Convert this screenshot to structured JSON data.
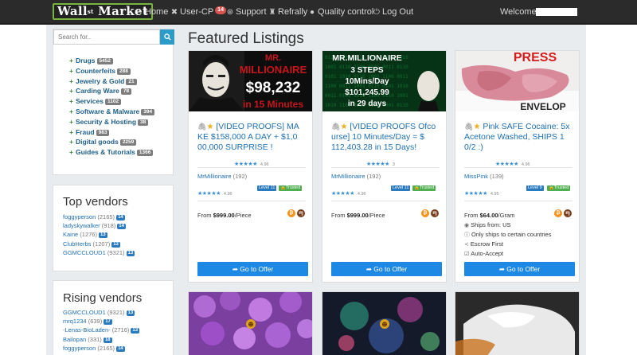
{
  "navbar": {
    "brand": "Wall",
    "brand_sup": "st",
    "brand_suffix": "Market",
    "links": [
      {
        "label": "Home",
        "icon": "home-icon"
      },
      {
        "label": "User-CP",
        "icon": "user-cp-icon",
        "badge": "14"
      },
      {
        "label": "Support",
        "icon": "support-icon"
      },
      {
        "label": "Refrally",
        "icon": "trophy-icon"
      },
      {
        "label": "Quality control",
        "icon": "quality-icon"
      },
      {
        "label": "Log Out",
        "icon": "logout-icon"
      }
    ],
    "welcome": "Welcome,"
  },
  "search": {
    "placeholder": "Search for.."
  },
  "categories": [
    {
      "name": "Drugs",
      "count": "5452"
    },
    {
      "name": "Counterfeits",
      "count": "288"
    },
    {
      "name": "Jewelry & Gold",
      "count": "21"
    },
    {
      "name": "Carding Ware",
      "count": "78"
    },
    {
      "name": "Services",
      "count": "1102"
    },
    {
      "name": "Software & Malware",
      "count": "394"
    },
    {
      "name": "Security & Hosting",
      "count": "38"
    },
    {
      "name": "Fraud",
      "count": "983"
    },
    {
      "name": "Digital goods",
      "count": "2259"
    },
    {
      "name": "Guides & Tutorials",
      "count": "1366"
    }
  ],
  "top_vendors": {
    "title": "Top vendors",
    "items": [
      {
        "name": "foggyperson",
        "count": "(2165)",
        "level": "14"
      },
      {
        "name": "ladyskywalker",
        "count": "(918)",
        "level": "14"
      },
      {
        "name": "Kaine",
        "count": "(1276)",
        "level": "13"
      },
      {
        "name": "ClubHerbs",
        "count": "(1207)",
        "level": "13"
      },
      {
        "name": "GGMCCLOUD1",
        "count": "(9321)",
        "level": "13"
      }
    ]
  },
  "rising_vendors": {
    "title": "Rising vendors",
    "items": [
      {
        "name": "GGMCCLOUD1",
        "count": "(9321)",
        "level": "13"
      },
      {
        "name": "mrq1234",
        "count": "(639)",
        "level": "17"
      },
      {
        "name": "-Lenas-BioLaden-",
        "count": "(2716)",
        "level": "13"
      },
      {
        "name": "Bailopan",
        "count": "(331)",
        "level": "18"
      },
      {
        "name": "foggyperson",
        "count": "(2165)",
        "level": "14"
      }
    ]
  },
  "main": {
    "title": "Featured Listings"
  },
  "listings": [
    {
      "img_lines": [
        "MR.",
        "MILLIONAIRE",
        "$98,232",
        "in 15 Minutes"
      ],
      "title": "[VIDEO PROOFS] MA KE $158,000 A DAY + $1,0 00,000 SURPRISE !",
      "stars": "★★★★★",
      "rating": "4.96",
      "vendor": "MrMillionaire",
      "vendor_count": "(192)",
      "vendor_stars": "★★★★★",
      "vendor_rating": "4.96",
      "level": "Level 11",
      "trusted": "Trusted",
      "price_prefix": "From ",
      "price": "$999.00",
      "price_unit": "/Piece",
      "details": [],
      "button": "Go to Offer"
    },
    {
      "img_lines": [
        "MR.MILLIONAIRE",
        "3 STEPS",
        "10Mins/Day",
        "$101,245.99",
        "in 29 days"
      ],
      "title": "[VIDEO PROOFS Ofco urse] 10 Minutes/Day = $ 112,403.28 in 15 Days!",
      "stars": "★★★★★",
      "rating": "3",
      "vendor": "MrMillionaire",
      "vendor_count": "(192)",
      "vendor_stars": "★★★★★",
      "vendor_rating": "4.96",
      "level": "Level 11",
      "trusted": "Trusted",
      "price_prefix": "From ",
      "price": "$999.00",
      "price_unit": "/Piece",
      "details": [],
      "button": "Go to Offer"
    },
    {
      "img_lines": [
        "PRESS",
        "ENVELOP"
      ],
      "title": "Pink SAFE Cocaine: 5x Acetone Washed, SHIPS 1 0/2 :)",
      "stars": "★★★★★",
      "rating": "4.96",
      "vendor": "MissPink",
      "vendor_count": "(139)",
      "vendor_stars": "★★★★★",
      "vendor_rating": "4.95",
      "level": "Level 9",
      "trusted": "Trusted",
      "price_prefix": "From ",
      "price": "$64.00",
      "price_unit": "/Gram",
      "details": [
        {
          "icon": "ship-icon",
          "text": "Ships from: US"
        },
        {
          "icon": "info-icon",
          "text": "Only ships to certain countries"
        },
        {
          "icon": "share-icon",
          "text": "Escrow First"
        },
        {
          "icon": "check-icon",
          "text": "Auto-Accept"
        }
      ],
      "button": "Go to Offer"
    }
  ],
  "colors": {
    "navbar_bg": "#2b2b2b",
    "brand_border": "#79b441",
    "link_blue": "#1f6fb2",
    "button_blue": "#1e88e5",
    "trusted_green": "#4fae4f",
    "badge_red": "#d9534f"
  }
}
